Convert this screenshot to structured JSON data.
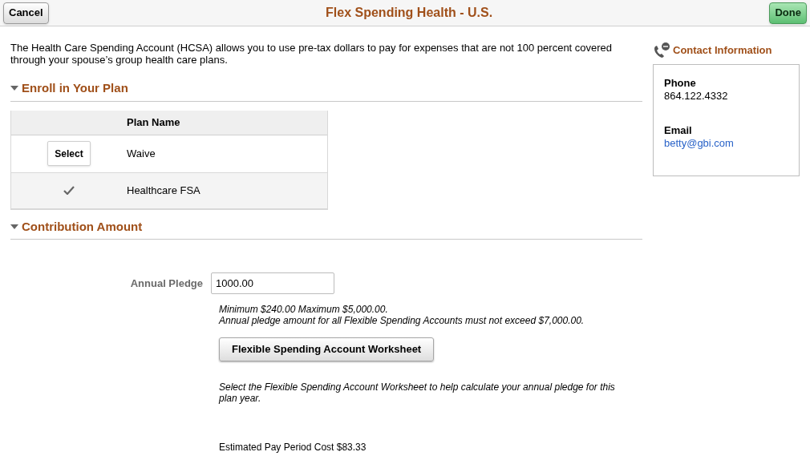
{
  "header": {
    "cancel_button": "Cancel",
    "title": "Flex Spending Health - U.S.",
    "done_button": "Done"
  },
  "intro": "The Health Care Spending Account (HCSA) allows you to use pre-tax dollars to pay for expenses that are not 100 percent covered through your spouse’s group health care plans.",
  "enroll_section": {
    "title": "Enroll in Your Plan",
    "expanded": true,
    "table": {
      "columns": [
        "Plan Name"
      ],
      "rows": [
        {
          "select_button": "Select",
          "plan_name": "Waive",
          "selected": false
        },
        {
          "plan_name": "Healthcare FSA",
          "selected": true
        }
      ]
    }
  },
  "contribution_section": {
    "title": "Contribution Amount",
    "expanded": true,
    "annual_pledge": {
      "label": "Annual Pledge",
      "value": "1000.00"
    },
    "limits": [
      "Minimum $240.00 Maximum $5,000.00.",
      "Annual pledge amount for all Flexible Spending Accounts must not exceed $7,000.00."
    ],
    "worksheet_button": "Flexible Spending Account Worksheet",
    "worksheet_hint": "Select the Flexible Spending Account Worksheet to help calculate your annual pledge for this plan year.",
    "estimated_cost": "Estimated Pay Period Cost $83.33"
  },
  "contact": {
    "title": "Contact Information",
    "phone_label": "Phone",
    "phone": "864.122.4332",
    "email_label": "Email",
    "email": "betty@gbi.com"
  }
}
